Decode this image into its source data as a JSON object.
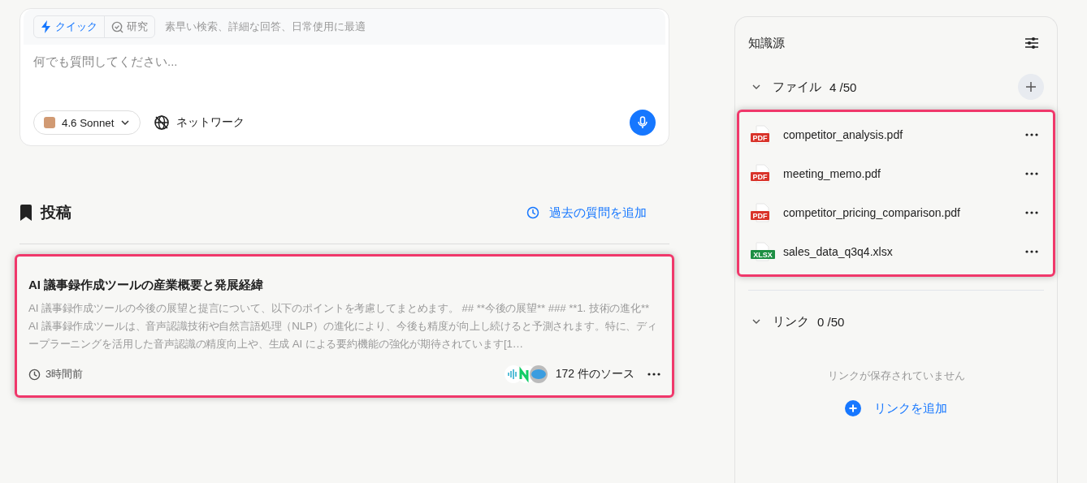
{
  "composer": {
    "modes": [
      {
        "label": "クイック",
        "selected": true
      },
      {
        "label": "研究",
        "selected": false
      }
    ],
    "mode_hint": "素早い検索、詳細な回答、日常使用に最適",
    "placeholder": "何でも質問してください...",
    "model": "4.6 Sonnet",
    "network": "ネットワーク"
  },
  "posts": {
    "title": "投稿",
    "add_past": "過去の質問を追加",
    "items": [
      {
        "title": "AI 議事録作成ツールの産業概要と発展経緯",
        "highlighted": true,
        "excerpt": "AI 議事録作成ツールの今後の展望と提言について、以下のポイントを考慮してまとめます。 ## **今後の展望** ### **1. 技術の進化** AI 議事録作成ツールは、音声認識技術や自然言語処理（NLP）の進化により、今後も精度が向上し続けると予測されます。特に、ディープラーニングを活用した音声認識の精度向上や、生成 AI による要約機能の強化が期待されています[1…",
        "time": "3時間前",
        "sources": "172 件のソース"
      }
    ]
  },
  "knowledge": {
    "title": "知識源",
    "sections": [
      {
        "kind": "files",
        "label": "ファイル",
        "count": "4 /50",
        "expanded": true,
        "highlighted": true,
        "items": [
          {
            "name": "competitor_analysis.pdf",
            "type": "PDF",
            "kind": "pdf"
          },
          {
            "name": "meeting_memo.pdf",
            "type": "PDF",
            "kind": "pdf"
          },
          {
            "name": "competitor_pricing_comparison.pdf",
            "type": "PDF",
            "kind": "pdf"
          },
          {
            "name": "sales_data_q3q4.xlsx",
            "type": "XLSX",
            "kind": "sheet"
          }
        ]
      },
      {
        "kind": "links",
        "label": "リンク",
        "count": "0 /50",
        "expanded": true,
        "empty_text": "リンクが保存されていません",
        "add_label": "リンクを追加"
      }
    ]
  }
}
